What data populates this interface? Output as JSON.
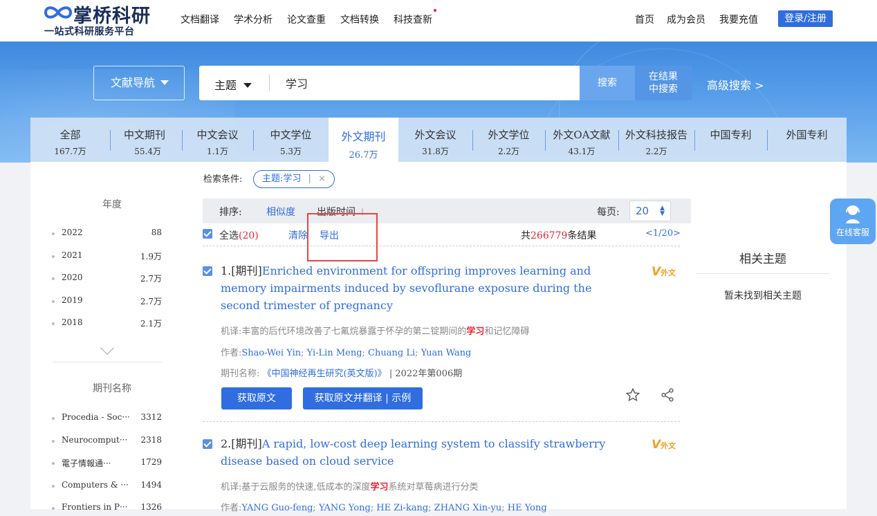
{
  "logo": {
    "name": "掌桥科研",
    "sub": "一站式科研服务平台",
    "accent": "#1a2d5a"
  },
  "nav": [
    "文档翻译",
    "学术分析",
    "论文查重",
    "文档转换",
    "科技查新"
  ],
  "top_right": {
    "home": "首页",
    "member": "成为会员",
    "recharge": "我要充值",
    "login": "登录/注册"
  },
  "search": {
    "nav_label": "文献导航",
    "field": "主题",
    "query": "学习",
    "search_btn": "搜索",
    "in_results_line1": "在结果",
    "in_results_line2": "中搜索",
    "advanced": "高级搜索 >"
  },
  "tabs": [
    {
      "title": "全部",
      "count": "167.7万"
    },
    {
      "title": "中文期刊",
      "count": "55.4万"
    },
    {
      "title": "中文会议",
      "count": "1.1万"
    },
    {
      "title": "中文学位",
      "count": "5.3万"
    },
    {
      "title": "外文期刊",
      "count": "26.7万",
      "active": true
    },
    {
      "title": "外文会议",
      "count": "31.8万"
    },
    {
      "title": "外文学位",
      "count": "2.2万"
    },
    {
      "title": "外文OA文献",
      "count": "43.1万"
    },
    {
      "title": "外文科技报告",
      "count": "2.2万"
    },
    {
      "title": "中国专利",
      "count": ""
    },
    {
      "title": "外国专利",
      "count": ""
    }
  ],
  "sidebar": {
    "year_title": "年度",
    "years": [
      {
        "label": "2022",
        "count": "88"
      },
      {
        "label": "2021",
        "count": "1.9万"
      },
      {
        "label": "2020",
        "count": "2.7万"
      },
      {
        "label": "2019",
        "count": "2.7万"
      },
      {
        "label": "2018",
        "count": "2.1万"
      }
    ],
    "journal_title": "期刊名称",
    "journals": [
      {
        "label": "Procedia - Soc···",
        "count": "3312"
      },
      {
        "label": "Neurocomput···",
        "count": "2318"
      },
      {
        "label": "電子情報通···",
        "count": "1729"
      },
      {
        "label": "Computers & ···",
        "count": "1494"
      },
      {
        "label": "Frontiers in P···",
        "count": "1326"
      }
    ]
  },
  "conditions": {
    "label": "检索条件:",
    "tag": "主题:学习",
    "tag_sep": "|",
    "tag_close": "×"
  },
  "sortbar": {
    "label": "排序:",
    "relevance": "相似度",
    "pubdate": "出版时间",
    "pubdate_arrow": "↓",
    "per_page_label": "每页:",
    "per_page": "20"
  },
  "actions": {
    "select_all": "全选",
    "selected_count": "(20)",
    "clear": "清除",
    "export": "导出",
    "total_prefix": "共",
    "total": "266779",
    "total_suffix": "条结果",
    "page": "<1/20>"
  },
  "results": [
    {
      "num": "1.",
      "type": "[期刊]",
      "title": "Enriched environment for offspring improves learning and memory impairments induced by sevoflurane exposure during the second trimester of pregnancy",
      "badge": "外文",
      "mt_label": "机译:",
      "mt_before": "丰富的后代环境改善了七氟烷暴露于怀孕的第二锭期间的",
      "mt_highlight": "学习",
      "mt_after": "和记忆障碍",
      "authors_label": "作者:",
      "authors": [
        "Shao-Wei Yin",
        "Yi-Lin Meng",
        "Chuang Li",
        "Yuan Wang"
      ],
      "journal_label": "期刊名称:",
      "journal": "《中国神经再生研究(英文版)》",
      "issue": "| 2022年第006期",
      "btn1": "获取原文",
      "btn2": "获取原文并翻译 | 示例"
    },
    {
      "num": "2.",
      "type": "[期刊]",
      "title": "A rapid, low-cost deep learning system to classify strawberry disease based on cloud service",
      "badge": "外文",
      "mt_label": "机译:",
      "mt_before": "基于云服务的快速,低成本的深度",
      "mt_highlight": "学习",
      "mt_after": "系统对草莓病进行分类",
      "authors_label": "作者:",
      "authors": [
        "YANG Guo-feng",
        "YANG Yong",
        "HE Zi-kang",
        "ZHANG Xin-yu",
        "HE Yong"
      ]
    }
  ],
  "related": {
    "title": "相关主题",
    "none": "暂未找到相关主题"
  },
  "customer_service": "在线客服"
}
